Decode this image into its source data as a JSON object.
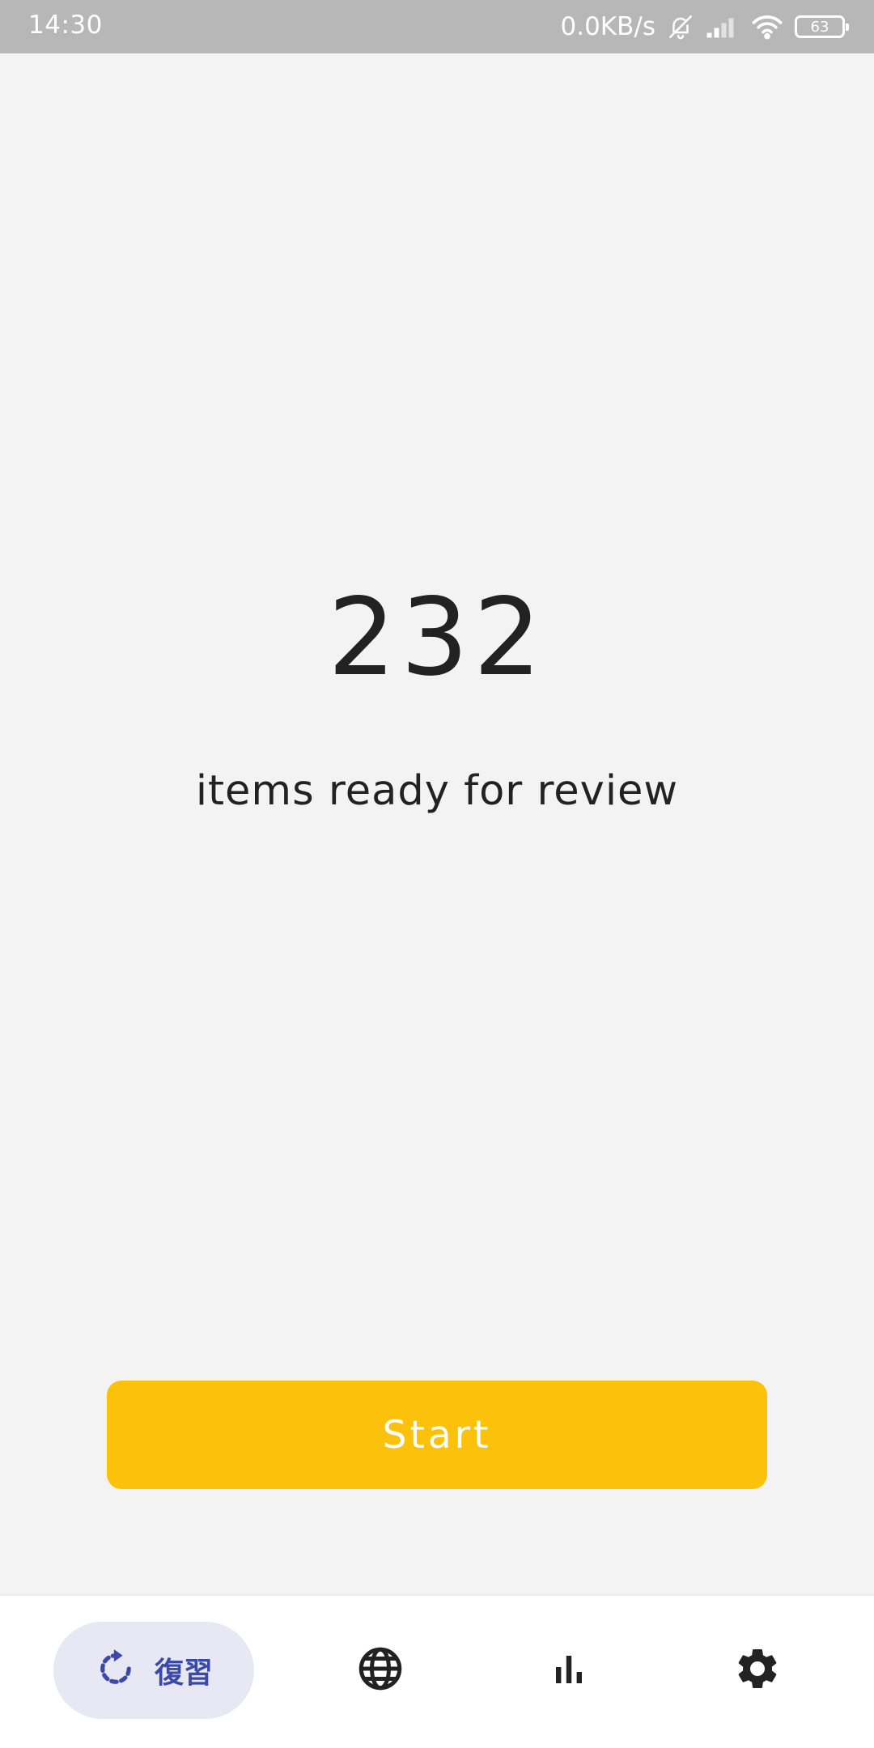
{
  "status_bar": {
    "time": "14:30",
    "net_speed": "0.0KB/s",
    "battery_level": "63",
    "icons": [
      "bell-off-icon",
      "signal-icon",
      "wifi-icon",
      "battery-icon"
    ]
  },
  "main": {
    "count": "232",
    "subtitle": "items ready for review",
    "start_label": "Start"
  },
  "bottom_nav": {
    "items": [
      {
        "label": "復習",
        "icon": "review-refresh-icon",
        "active": true
      },
      {
        "label": "",
        "icon": "globe-icon",
        "active": false
      },
      {
        "label": "",
        "icon": "bar-chart-icon",
        "active": false
      },
      {
        "label": "",
        "icon": "gear-icon",
        "active": false
      }
    ]
  },
  "colors": {
    "accent_button": "#fcc10a",
    "active_nav_bg": "#e8e8f4",
    "active_nav_fg": "#3b4aa8",
    "status_bar_bg": "#b7b7b7",
    "background": "#f3f3f3"
  }
}
